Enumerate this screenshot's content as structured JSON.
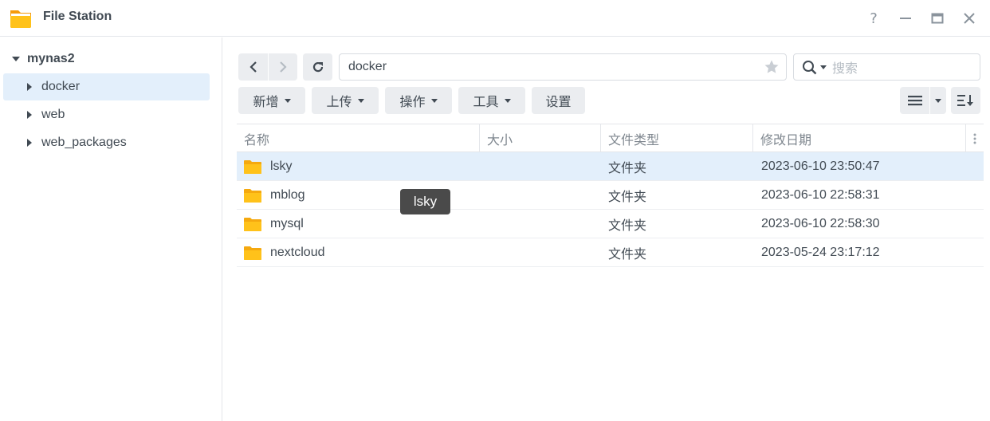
{
  "window": {
    "title": "File Station",
    "controls": [
      "help-icon",
      "minimize-icon",
      "maximize-icon",
      "close-icon"
    ]
  },
  "sidebar": {
    "root": "mynas2",
    "items": [
      {
        "label": "docker",
        "selected": true
      },
      {
        "label": "web",
        "selected": false
      },
      {
        "label": "web_packages",
        "selected": false
      }
    ]
  },
  "toolbar": {
    "path": "docker",
    "search_placeholder": "搜索",
    "buttons": {
      "new": "新增",
      "upload": "上传",
      "action": "操作",
      "tools": "工具",
      "settings": "设置"
    }
  },
  "table": {
    "columns": {
      "name": "名称",
      "size": "大小",
      "type": "文件类型",
      "modified": "修改日期"
    },
    "rows": [
      {
        "name": "lsky",
        "size": "",
        "type": "文件夹",
        "modified": "2023-06-10 23:50:47",
        "selected": true
      },
      {
        "name": "mblog",
        "size": "",
        "type": "文件夹",
        "modified": "2023-06-10 22:58:31",
        "selected": false
      },
      {
        "name": "mysql",
        "size": "",
        "type": "文件夹",
        "modified": "2023-06-10 22:58:30",
        "selected": false
      },
      {
        "name": "nextcloud",
        "size": "",
        "type": "文件夹",
        "modified": "2023-05-24 23:17:12",
        "selected": false
      }
    ]
  },
  "tooltip": {
    "text": "lsky"
  },
  "colors": {
    "accent_selection": "#e3effb",
    "folder_yellow": "#ffb81c",
    "button_bg": "#ebedf0",
    "text": "#414a53"
  }
}
